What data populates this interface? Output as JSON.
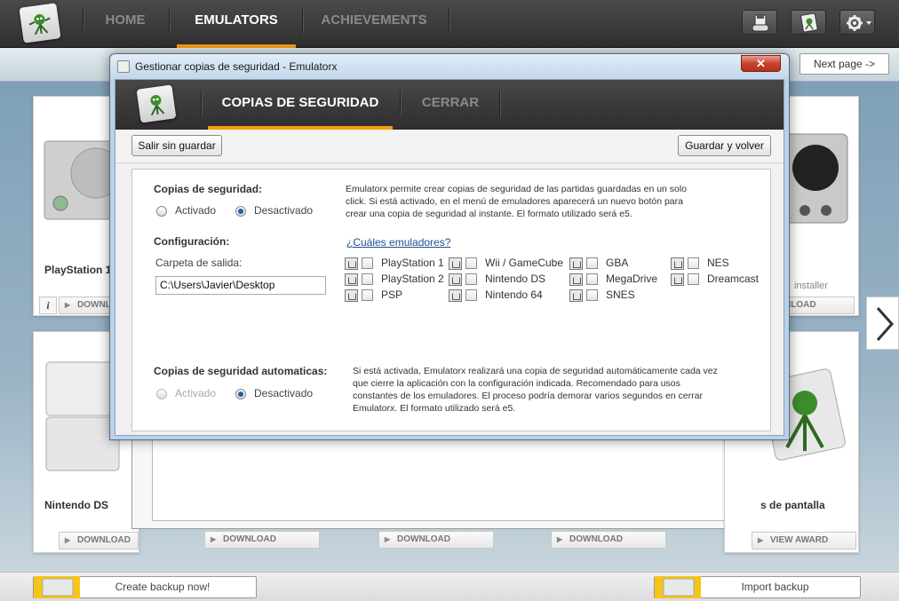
{
  "nav": {
    "tabs": [
      {
        "label": "HOME",
        "active": false
      },
      {
        "label": "EMULATORS",
        "active": true
      },
      {
        "label": "ACHIEVEMENTS",
        "active": false
      }
    ],
    "tools": [
      "floppy-gamepad-icon",
      "logo-icon",
      "gear-icon"
    ]
  },
  "page": {
    "next_page": "Next page ->",
    "cards_top": [
      {
        "name": "PlayStation 1",
        "button": "DOWNLOAD"
      },
      {
        "name": "",
        "button": "DOWNLOAD",
        "sub": "installer"
      }
    ],
    "cards_bottom": [
      {
        "name": "Nintendo DS",
        "button": "DOWNLOAD"
      },
      {
        "button": "DOWNLOAD"
      },
      {
        "button": "DOWNLOAD"
      },
      {
        "button": "DOWNLOAD"
      },
      {
        "name": "s de pantalla",
        "button": "VIEW AWARD"
      }
    ],
    "create_backup": "Create backup now!",
    "import_backup": "Import backup",
    "card_installer_label": "installer",
    "card_download_short": "DOWNL",
    "card_download_right": "NLOAD"
  },
  "dialog": {
    "title": "Gestionar copias de seguridad - Emulatorx",
    "close_glyph": "✕",
    "tabs": [
      {
        "label": "COPIAS DE SEGURIDAD",
        "active": true
      },
      {
        "label": "CERRAR",
        "active": false
      }
    ],
    "exit_button": "Salir sin guardar",
    "save_button": "Guardar y volver",
    "backups": {
      "label": "Copias de seguridad:",
      "opt_on": "Activado",
      "opt_off": "Desactivado",
      "selected": "Desactivado",
      "description": "Emulatorx permite crear copias de seguridad de las partidas guardadas en un solo click. Si está activado, en el menú de emuladores aparecerá un nuevo botón para crear una copia de seguridad al instante. El formato utilizado será e5."
    },
    "config": {
      "label": "Configuración:",
      "output_label": "Carpeta de salida:",
      "output_value": "C:\\Users\\Javier\\Desktop",
      "which_link": "¿Cuáles emuladores?",
      "emulators": [
        [
          "PlayStation 1",
          "PlayStation 2",
          "PSP"
        ],
        [
          "Wii / GameCube",
          "Nintendo DS",
          "Nintendo 64"
        ],
        [
          "GBA",
          "MegaDrive",
          "SNES"
        ],
        [
          "NES",
          "Dreamcast"
        ]
      ]
    },
    "auto": {
      "label": "Copias de seguridad automaticas:",
      "opt_on": "Activado",
      "opt_off": "Desactivado",
      "selected": "Desactivado",
      "description": "Si está activada, Emulatorx realizará una copia de seguridad automáticamente cada vez que cierre la aplicación con la configuración indicada. Recomendado para usos constantes de los emuladores. El proceso podría demorar varios segundos en cerrar Emulatorx. El formato utilizado será e5."
    }
  },
  "colors": {
    "accent": "#f39c12",
    "link": "#1d4e91",
    "topbar": "#3a3a3a"
  }
}
